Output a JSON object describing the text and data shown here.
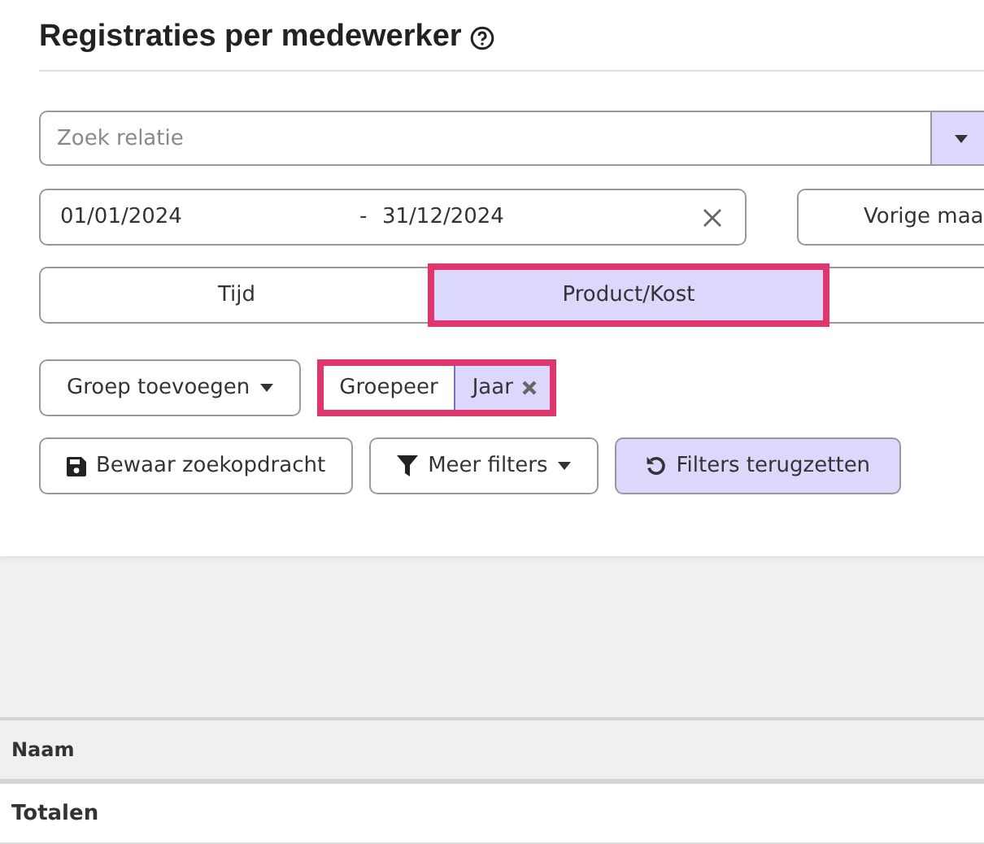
{
  "title": "Registraties per medewerker",
  "search": {
    "placeholder": "Zoek relatie"
  },
  "date_range": {
    "from": "01/01/2024",
    "separator": "-",
    "to": "31/12/2024"
  },
  "preset_button": "Vorige maa",
  "tabs": [
    {
      "label": "Tijd",
      "selected": false,
      "highlighted": false
    },
    {
      "label": "Product/Kost",
      "selected": true,
      "highlighted": true
    }
  ],
  "group_button": "Groep toevoegen",
  "grouping": {
    "label": "Groepeer",
    "highlighted": true,
    "chips": [
      {
        "label": "Jaar"
      }
    ]
  },
  "actions": [
    {
      "kind": "save",
      "label": "Bewaar zoekopdracht",
      "primary": false
    },
    {
      "kind": "filter",
      "label": "Meer filters",
      "primary": false
    },
    {
      "kind": "reset",
      "label": "Filters terugzetten",
      "primary": true
    }
  ],
  "table": {
    "columns": [
      "Naam"
    ],
    "rows": [
      [
        "Totalen"
      ]
    ]
  }
}
